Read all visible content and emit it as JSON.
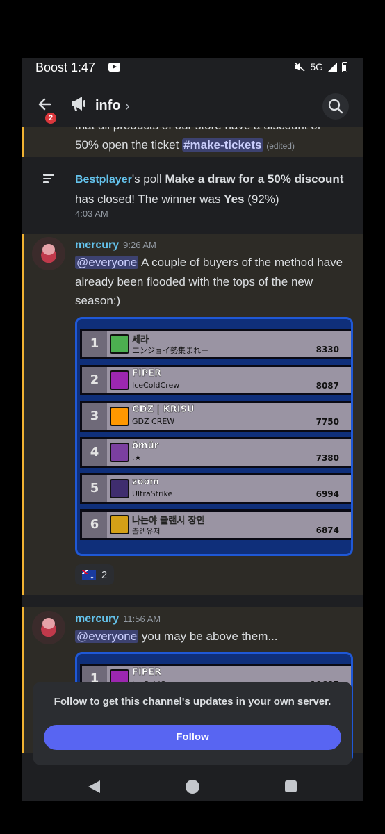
{
  "status": {
    "carrier_time": "Boost 1:47",
    "network": "5G"
  },
  "header": {
    "badge": "2",
    "channel": "info",
    "chevron": "›"
  },
  "messages": {
    "prev_line1": "that all products of our store have a discount of",
    "prev_line2_text": "50% open the ticket ",
    "prev_channel": "#make-tickets",
    "prev_edited": "(edited)",
    "poll": {
      "user": "Bestplayer",
      "t1": "'s poll ",
      "title": "Make a draw for a 50% discount",
      "t2": " has closed! The winner was ",
      "winner": "Yes",
      "t3": " (92%)",
      "time": "4:03 AM"
    },
    "msg1": {
      "author": "mercury",
      "time": "9:26 AM",
      "mention": "@everyone",
      "text": " A couple of buyers of the method have already been flooded with the tops of the new season:)"
    },
    "reaction_count": "2",
    "msg2": {
      "author": "mercury",
      "time": "11:56 AM",
      "mention": "@everyone",
      "text": "  you may be above them..."
    }
  },
  "leaderboard": [
    {
      "rank": "1",
      "name": "세라",
      "sub": "エンジョイ勢集まれー",
      "score": "8330",
      "icon_color": "#4caf50"
    },
    {
      "rank": "2",
      "name": "FIPER",
      "sub": "IceColdCrew",
      "score": "8087",
      "icon_color": "#9c27b0"
    },
    {
      "rank": "3",
      "name": "GDZ | KRISU",
      "sub": "GDZ CREW",
      "score": "7750",
      "icon_color": "#ff9800"
    },
    {
      "rank": "4",
      "name": "ömür",
      "sub": ".★",
      "score": "7380",
      "icon_color": "#7b3fa0"
    },
    {
      "rank": "5",
      "name": "zoom",
      "sub": "UltraStrike",
      "score": "6994",
      "icon_color": "#3f2d6e"
    },
    {
      "rank": "6",
      "name": "나는야 클랜시 장인",
      "sub": "츨겜유저",
      "score": "6874",
      "icon_color": "#d4a017"
    }
  ],
  "leaderboard2": [
    {
      "rank": "1",
      "name": "FIPER",
      "sub": "IceColdCrew",
      "score": "10687",
      "icon_color": "#9c27b0"
    }
  ],
  "follow": {
    "text": "Follow to get this channel's updates in your own server.",
    "button": "Follow"
  }
}
